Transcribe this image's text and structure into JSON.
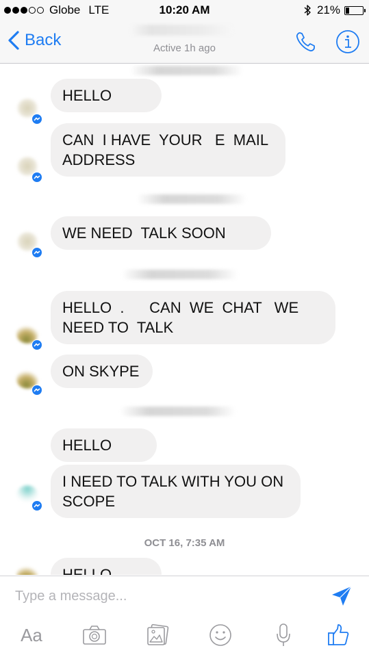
{
  "status_bar": {
    "carrier": "Globe",
    "network": "LTE",
    "time": "10:20 AM",
    "battery_percent": "21%",
    "battery_level": 0.21,
    "signal_bars_filled": 3,
    "signal_bars_total": 5
  },
  "nav": {
    "back_label": "Back",
    "active_status": "Active 1h ago",
    "accent_color": "#1e7cf2"
  },
  "messages": [
    {
      "text": "HELLO"
    },
    {
      "text": "CAN  I HAVE  YOUR   E  MAIL\nADDRESS"
    },
    {
      "text": "WE NEED  TALK SOON"
    },
    {
      "text": "HELLO  .      CAN  WE  CHAT   WE\nNEED TO  TALK"
    },
    {
      "text": "ON SKYPE"
    },
    {
      "text": "HELLO"
    },
    {
      "text": "I NEED TO TALK WITH YOU ON\nSCOPE"
    },
    {
      "text": "HELLO"
    }
  ],
  "date_label": "OCT 16, 7:35 AM",
  "compose": {
    "placeholder": "Type a message...",
    "text_format_label": "Aa"
  },
  "icons": {
    "back": "chevron-left-icon",
    "call": "phone-icon",
    "info": "info-icon",
    "send": "send-icon",
    "camera": "camera-icon",
    "photos": "photo-icon",
    "emoji": "emoji-icon",
    "mic": "microphone-icon",
    "like": "thumbs-up-icon"
  },
  "colors": {
    "bubble_received": "#f1f0f0",
    "muted_text": "#8e8e93",
    "messenger_blue": "#1e7cf2"
  }
}
